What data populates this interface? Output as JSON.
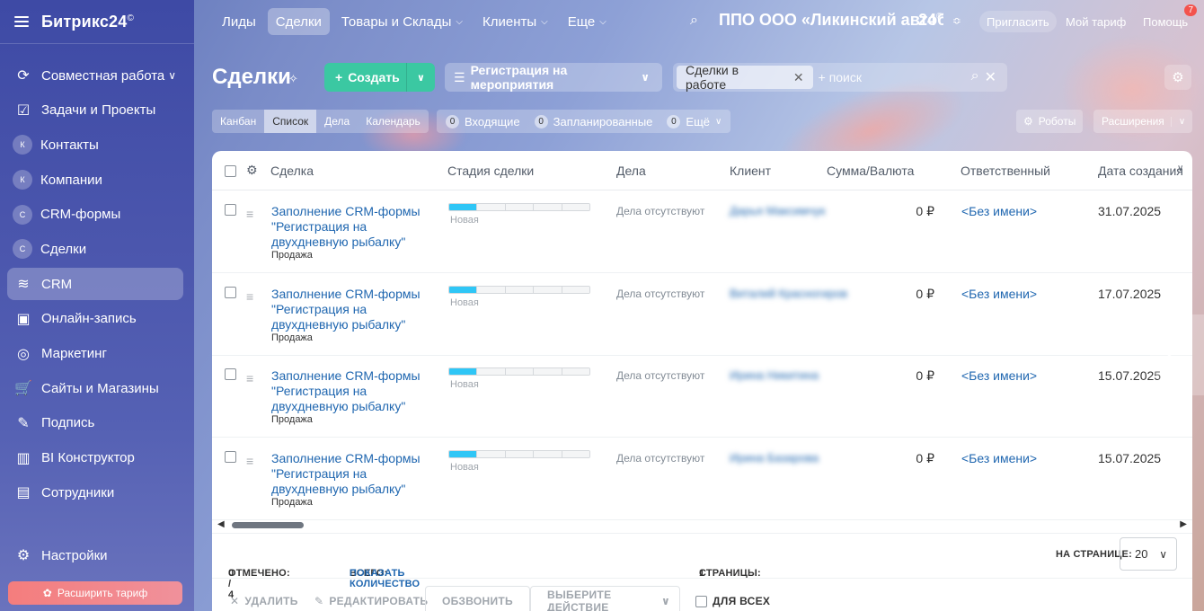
{
  "sidebar": {
    "logo": "Битрикс24",
    "logo_mark": "©",
    "items": [
      {
        "label": "Совместная работа",
        "icon": "⟳",
        "chev": "∨"
      },
      {
        "label": "Задачи и Проекты",
        "icon": "☑"
      },
      {
        "label": "Контакты",
        "badge": "К"
      },
      {
        "label": "Компании",
        "badge": "К"
      },
      {
        "label": "CRM-формы",
        "badge": "С"
      },
      {
        "label": "Сделки",
        "badge": "С"
      },
      {
        "label": "CRM",
        "icon": "≋"
      },
      {
        "label": "Онлайн-запись",
        "icon": "▣"
      },
      {
        "label": "Маркетинг",
        "icon": "◎"
      },
      {
        "label": "Сайты и Магазины",
        "icon": "🛒"
      },
      {
        "label": "Подпись",
        "icon": "✎"
      },
      {
        "label": "BI Конструктор",
        "icon": "▥"
      },
      {
        "label": "Сотрудники",
        "icon": "▤"
      }
    ],
    "settings": "Настройки",
    "tariff": "Расширить тариф"
  },
  "topbar": {
    "nav": [
      "Лиды",
      "Сделки",
      "Товары и Склады",
      "Клиенты",
      "Еще"
    ],
    "org": "ППО ООО «Ликинский автобус»",
    "org_suffix": "24",
    "invite": "Пригласить",
    "plan": "Мой тариф",
    "help": "Помощь",
    "help_badge": "7"
  },
  "header": {
    "title": "Сделки",
    "create": "Создать",
    "funnel": "Регистрация на мероприятия",
    "filter_chip": "Сделки в работе",
    "search_placeholder": "+ поиск"
  },
  "views": [
    "Канбан",
    "Список",
    "Дела",
    "Календарь"
  ],
  "counters": [
    {
      "n": "0",
      "label": "Входящие"
    },
    {
      "n": "0",
      "label": "Запланированные"
    },
    {
      "n": "0",
      "label": "Ещё"
    }
  ],
  "robots": "Роботы",
  "extensions": "Расширения",
  "columns": [
    "Сделка",
    "Стадия сделки",
    "Дела",
    "Клиент",
    "Сумма/Валюта",
    "Ответственный",
    "Дата создания"
  ],
  "rows": [
    {
      "title": "Заполнение CRM-формы \"Регистрация на двухдневную рыбалку\"",
      "category": "Продажа",
      "stage": "Новая",
      "acts": "Дела отсутствуют",
      "client": "Дарья Максимчук",
      "sum": "0 ₽",
      "resp": "<Без имени>",
      "date": "31.07.2025"
    },
    {
      "title": "Заполнение CRM-формы \"Регистрация на двухдневную рыбалку\"",
      "category": "Продажа",
      "stage": "Новая",
      "acts": "Дела отсутствуют",
      "client": "Виталий Красногиров",
      "sum": "0 ₽",
      "resp": "<Без имени>",
      "date": "17.07.2025"
    },
    {
      "title": "Заполнение CRM-формы \"Регистрация на двухдневную рыбалку\"",
      "category": "Продажа",
      "stage": "Новая",
      "acts": "Дела отсутствуют",
      "client": "Ирина Никитина",
      "sum": "0 ₽",
      "resp": "<Без имени>",
      "date": "15.07.2025"
    },
    {
      "title": "Заполнение CRM-формы \"Регистрация на двухдневную рыбалку\"",
      "category": "Продажа",
      "stage": "Новая",
      "acts": "Дела отсутствуют",
      "client": "Ирина Базарова",
      "sum": "0 ₽",
      "resp": "<Без имени>",
      "date": "15.07.2025"
    }
  ],
  "footer": {
    "marked_label": "Отмечено:",
    "marked_value": "0 / 4",
    "total_label": "Всего:",
    "total_link": "Показать количество",
    "pages_label": "Страницы:",
    "pages_value": "1",
    "per_page_label": "На странице:",
    "per_page_value": "20"
  },
  "actions": {
    "delete": "Удалить",
    "edit": "Редактировать",
    "call": "Обзвонить",
    "choose": "Выберите действие",
    "for_all": "Для всех"
  }
}
